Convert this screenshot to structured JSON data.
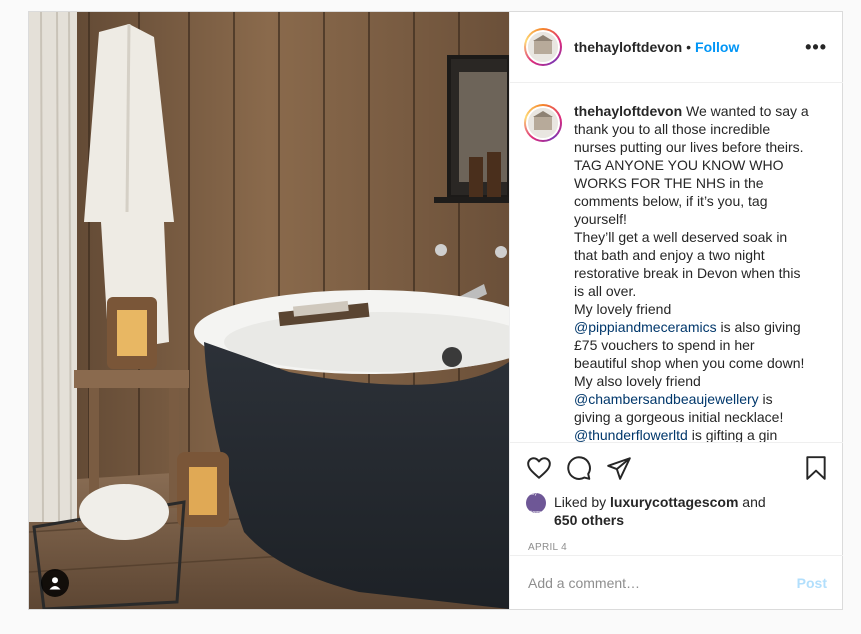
{
  "post": {
    "username": "thehayloftdevon",
    "follow_label": "Follow",
    "separator": "•",
    "more_label": "•••",
    "caption_lines": [
      "We wanted to say a",
      "thank you to all those incredible",
      "nurses putting our lives before theirs.",
      "TAG ANYONE YOU KNOW WHO",
      "WORKS FOR THE NHS in the",
      "comments below, if it’s you, tag",
      "yourself!",
      "They’ll get a well deserved soak in",
      "that bath and enjoy a two night",
      "restorative break in Devon when this",
      "is all over.",
      "My lovely friend"
    ],
    "mention_1": "@pippiandmeceramics",
    "line_after_mention_1": " is also giving",
    "caption_lines_2": [
      "£75 vouchers to spend in her",
      "beautiful shop when you come down!",
      "My also lovely friend"
    ],
    "mention_2": "@chambersandbeaujewellery",
    "line_after_mention_2": " is",
    "caption_lines_3": [
      "giving a gorgeous initial necklace!"
    ],
    "mention_3": "@thunderflowerltd",
    "line_after_mention_3": " is gifting a gin",
    "liked_by_prefix": "Liked by ",
    "liked_by_user": "luxurycottagescom",
    "liked_by_and": " and",
    "liked_by_others": "650 others",
    "liker_avatar_text": "luxury cottages",
    "date": "APRIL 4",
    "comment_placeholder": "Add a comment…",
    "post_button": "Post"
  },
  "icons": [
    "tag-people-icon",
    "heart-icon",
    "comment-icon",
    "share-icon",
    "bookmark-icon",
    "more-icon"
  ],
  "colors": {
    "follow": "#0095f6",
    "mention": "#00376b",
    "post_disabled": "#b2dffc",
    "date": "#8e8e8e"
  }
}
